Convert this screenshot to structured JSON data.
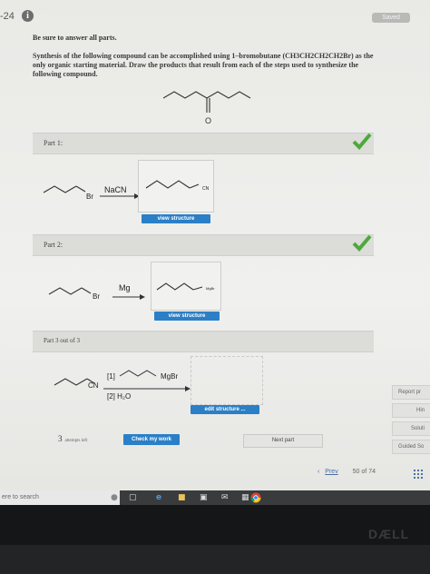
{
  "header": {
    "question_number": "-24",
    "info_icon": "i",
    "saved_label": "Saved"
  },
  "instructions": "Be sure to answer all parts.",
  "prompt": "Synthesis of the following compound can be accomplished using 1–bromobutane (CH3CH2CH2CH2Br) as the only organic starting material. Draw the products that result from each of the steps used to synthesize the following compound.",
  "target_label": "O",
  "parts": [
    {
      "label": "Part 1:",
      "complete": true,
      "reactant_label": "Br",
      "reagent": "NaCN",
      "product_label": "CN",
      "button": "view structure"
    },
    {
      "label": "Part 2:",
      "complete": true,
      "reactant_label": "Br",
      "reagent": "Mg",
      "product_label": "MgBr",
      "button": "view structure"
    },
    {
      "label": "Part 3 out of 3",
      "complete": false,
      "reactant_label": "CN",
      "reagent_step1": "[1]",
      "reagent_step1_label": "MgBr",
      "reagent_step2": "[2] H₂O",
      "button": "edit structure ..."
    }
  ],
  "footer": {
    "attempts_count": "3",
    "attempts_label": "attempts left",
    "check_button": "Check my work",
    "next_button": "Next part",
    "prev_link": "Prev",
    "page_current": "50",
    "page_of": "of",
    "page_total": "74"
  },
  "side_buttons": [
    "Report pr",
    "Hin",
    "Soluti",
    "Guided So"
  ],
  "taskbar": {
    "search_placeholder": "ere to search"
  },
  "monitor": {
    "brand": "DÆLL"
  },
  "colors": {
    "accent": "#2b7fc6",
    "check": "#4caa3a"
  }
}
